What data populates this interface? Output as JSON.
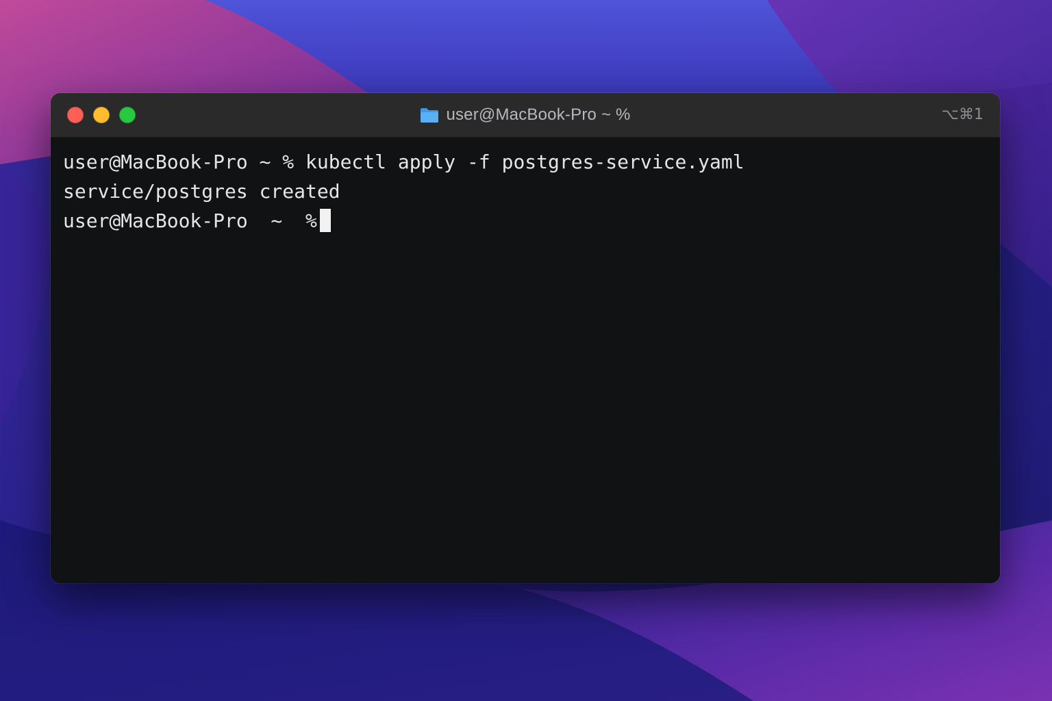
{
  "window": {
    "title": "user@MacBook-Pro ~ %",
    "shortcut": "⌥⌘1",
    "title_icon": "folder-icon",
    "traffic_lights": {
      "close": "#fe5f57",
      "minimize": "#febc2e",
      "zoom": "#28c840"
    }
  },
  "terminal": {
    "lines": [
      "user@MacBook-Pro ~ % kubectl apply -f postgres-service.yaml",
      "service/postgres created"
    ],
    "prompt": "user@MacBook-Pro  ~  %",
    "background": "#111213",
    "foreground": "#e6e6e6"
  }
}
